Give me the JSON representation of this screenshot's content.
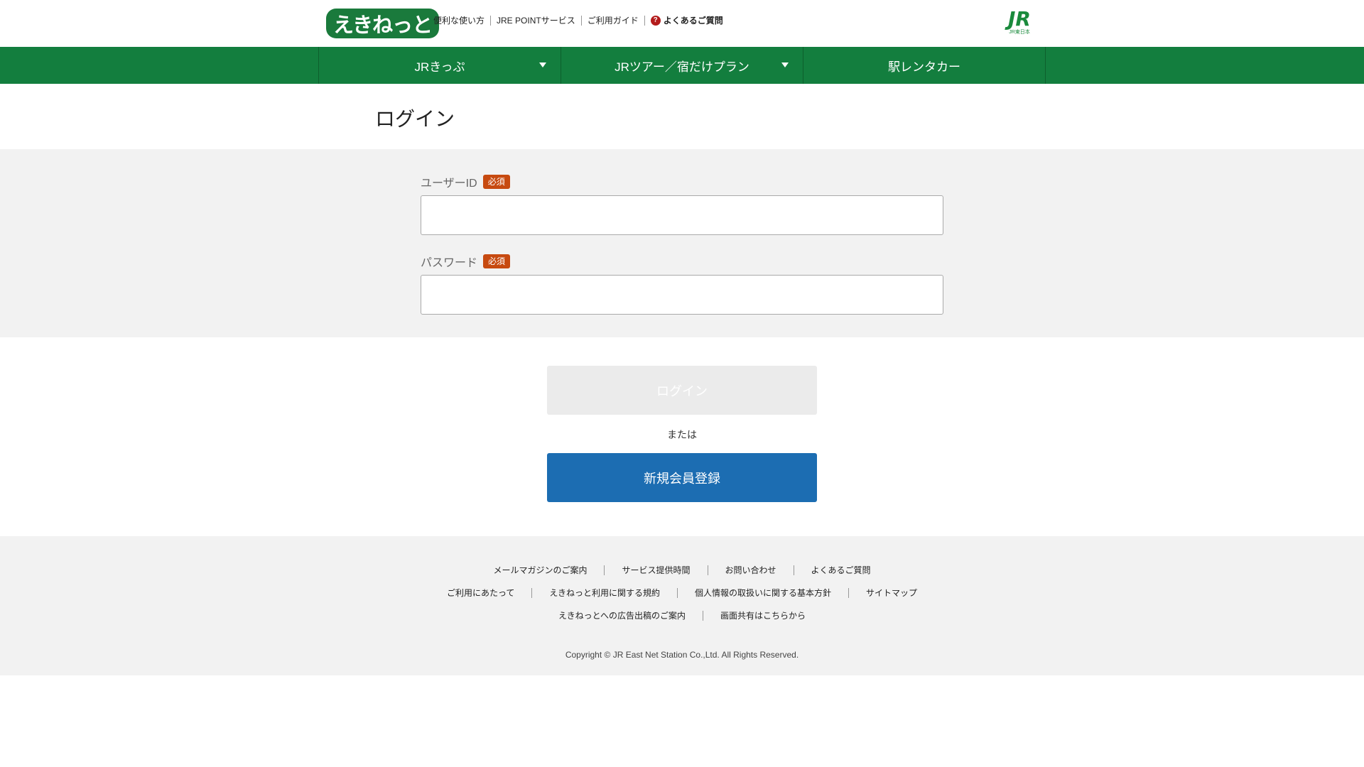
{
  "header": {
    "logo_text": "えきねっと",
    "links": [
      "便利な使い方",
      "JRE POINTサービス",
      "ご利用ガイド"
    ],
    "faq_label": "よくあるご質問",
    "jr_logo_text": "JR",
    "jr_logo_sub": "JR東日本"
  },
  "nav": {
    "items": [
      {
        "label": "JRきっぷ"
      },
      {
        "label": "JRツアー／宿だけプラン"
      },
      {
        "label": "駅レンタカー"
      }
    ]
  },
  "main": {
    "title": "ログイン",
    "userid_label": "ユーザーID",
    "password_label": "パスワード",
    "required_badge": "必須",
    "login_button": "ログイン",
    "or_text": "または",
    "register_button": "新規会員登録"
  },
  "footer": {
    "row1": [
      "メールマガジンのご案内",
      "サービス提供時間",
      "お問い合わせ",
      "よくあるご質問"
    ],
    "row2": [
      "ご利用にあたって",
      "えきねっと利用に関する規約",
      "個人情報の取扱いに関する基本方針",
      "サイトマップ"
    ],
    "row3": [
      "えきねっとへの広告出稿のご案内",
      "画面共有はこちらから"
    ],
    "copyright": "Copyright © JR East Net Station Co.,Ltd. All Rights Reserved."
  },
  "colors": {
    "nav_green": "#137e3e",
    "badge_orange": "#c74a10",
    "register_blue": "#1c6db2"
  }
}
